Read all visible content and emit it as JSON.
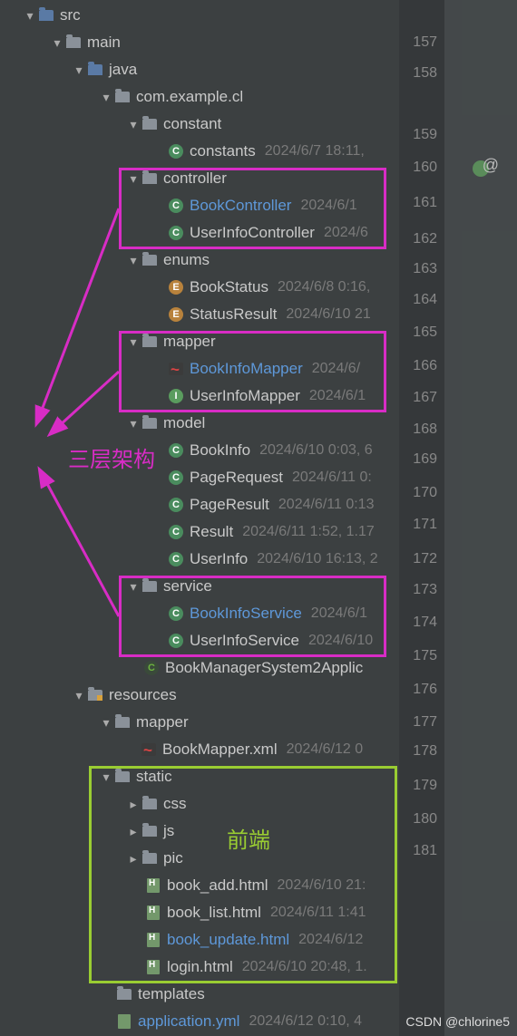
{
  "tree": {
    "src": "src",
    "main": "main",
    "java": "java",
    "package": "com.example.cl",
    "constant": "constant",
    "constants": "constants",
    "constants_meta": "2024/6/7 18:11,",
    "controller": "controller",
    "bookController": "BookController",
    "bookController_meta": "2024/6/1",
    "userInfoController": "UserInfoController",
    "userInfoController_meta": "2024/6",
    "enums": "enums",
    "bookStatus": "BookStatus",
    "bookStatus_meta": "2024/6/8 0:16,",
    "statusResult": "StatusResult",
    "statusResult_meta": "2024/6/10 21",
    "mapper": "mapper",
    "bookInfoMapper": "BookInfoMapper",
    "bookInfoMapper_meta": "2024/6/",
    "userInfoMapper": "UserInfoMapper",
    "userInfoMapper_meta": "2024/6/1",
    "model": "model",
    "bookInfo": "BookInfo",
    "bookInfo_meta": "2024/6/10 0:03, 6",
    "pageRequest": "PageRequest",
    "pageRequest_meta": "2024/6/11 0:",
    "pageResult": "PageResult",
    "pageResult_meta": "2024/6/11 0:13",
    "result": "Result",
    "result_meta": "2024/6/11 1:52, 1.17",
    "userInfo": "UserInfo",
    "userInfo_meta": "2024/6/10 16:13, 2",
    "service": "service",
    "bookInfoService": "BookInfoService",
    "bookInfoService_meta": "2024/6/1",
    "userInfoService": "UserInfoService",
    "userInfoService_meta": "2024/6/10",
    "springApp": "BookManagerSystem2Applic",
    "resources": "resources",
    "mapper2": "mapper",
    "bookMapperXml": "BookMapper.xml",
    "bookMapperXml_meta": "2024/6/12 0",
    "static": "static",
    "css": "css",
    "js": "js",
    "pic": "pic",
    "bookAdd": "book_add.html",
    "bookAdd_meta": "2024/6/10 21:",
    "bookList": "book_list.html",
    "bookList_meta": "2024/6/11 1:41",
    "bookUpdate": "book_update.html",
    "bookUpdate_meta": "2024/6/12",
    "login": "login.html",
    "login_meta": "2024/6/10 20:48, 1.",
    "templates": "templates",
    "appYml": "application.yml",
    "appYml_meta": "2024/6/12 0:10, 4"
  },
  "gutter": {
    "n157": "157",
    "n158": "158",
    "n159": "159",
    "n160": "160",
    "n161": "161",
    "n162": "162",
    "n163": "163",
    "n164": "164",
    "n165": "165",
    "n166": "166",
    "n167": "167",
    "n168": "168",
    "n169": "169",
    "n170": "170",
    "n171": "171",
    "n172": "172",
    "n173": "173",
    "n174": "174",
    "n175": "175",
    "n176": "176",
    "n177": "177",
    "n178": "178",
    "n179": "179",
    "n180": "180",
    "n181": "181"
  },
  "annotations": {
    "threeLayer": "三层架构",
    "frontend": "前端",
    "at": "@"
  },
  "watermark": "CSDN @chlorine5"
}
